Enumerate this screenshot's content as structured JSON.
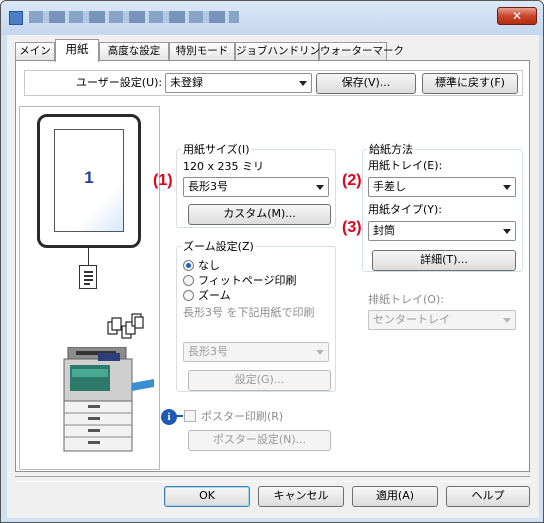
{
  "window": {
    "close_label": "✕"
  },
  "tabs": [
    {
      "label": "メイン"
    },
    {
      "label": "用紙"
    },
    {
      "label": "高度な設定"
    },
    {
      "label": "特別モード"
    },
    {
      "label": "ジョブハンドリング"
    },
    {
      "label": "ウォーターマーク"
    }
  ],
  "user_settings": {
    "label": "ユーザー設定(U):",
    "value": "未登録",
    "save_button": "保存(V)...",
    "reset_button": "標準に戻す(F)"
  },
  "preview": {
    "page_number": "1"
  },
  "paper_size": {
    "group_title": "用紙サイズ(I)",
    "dimensions": "120 x 235 ミリ",
    "value": "長形3号",
    "custom_button": "カスタム(M)..."
  },
  "zoom": {
    "group_title": "ズーム設定(Z)",
    "options": [
      "なし",
      "フィットページ印刷",
      "ズーム"
    ],
    "selected_option": "なし",
    "fit_note": "長形3号 を下記用紙で印刷",
    "target_paper": "長形3号",
    "settings_button": "設定(G)..."
  },
  "poster": {
    "checkbox_label": "ポスター印刷(R)",
    "checked": false,
    "settings_button": "ポスター設定(N)..."
  },
  "paper_source": {
    "group_title": "給紙方法",
    "tray_label": "用紙トレイ(E):",
    "tray_value": "手差し",
    "type_label": "用紙タイプ(Y):",
    "type_value": "封筒",
    "details_button": "詳細(T)..."
  },
  "output_tray": {
    "label": "排紙トレイ(O):",
    "value": "センタートレイ"
  },
  "markers": {
    "m1": "(1)",
    "m2": "(2)",
    "m3": "(3)"
  },
  "info_icon_glyph": "i",
  "footer": {
    "ok": "OK",
    "cancel": "キャンセル",
    "apply": "適用(A)",
    "help": "ヘルプ"
  },
  "colors": {
    "marker_red": "#e2001a",
    "title_bar": "#c4d7ef",
    "accent_blue": "#1f5fbf"
  }
}
